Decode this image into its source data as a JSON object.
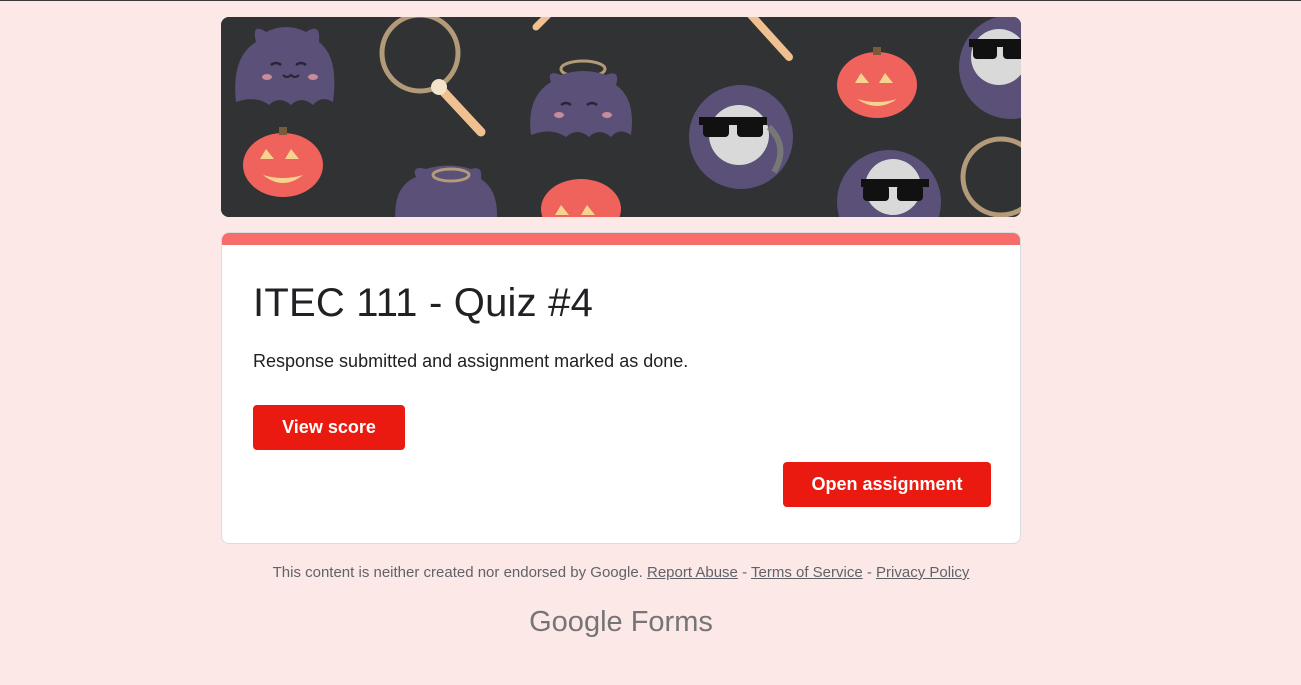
{
  "banner": {
    "theme": "halloween-pattern",
    "background_color": "#303234"
  },
  "form": {
    "title": "ITEC 111 - Quiz #4",
    "message": "Response submitted and assignment marked as done.",
    "accent_color": "#f76d6a",
    "view_score_label": "View score",
    "open_assignment_label": "Open assignment",
    "button_color": "#ea1a10"
  },
  "footer": {
    "disclaimer": "This content is neither created nor endorsed by Google.",
    "report_abuse": "Report Abuse",
    "separator": "-",
    "terms": "Terms of Service",
    "privacy": "Privacy Policy"
  },
  "brand": {
    "google": "Google",
    "forms": "Forms"
  }
}
